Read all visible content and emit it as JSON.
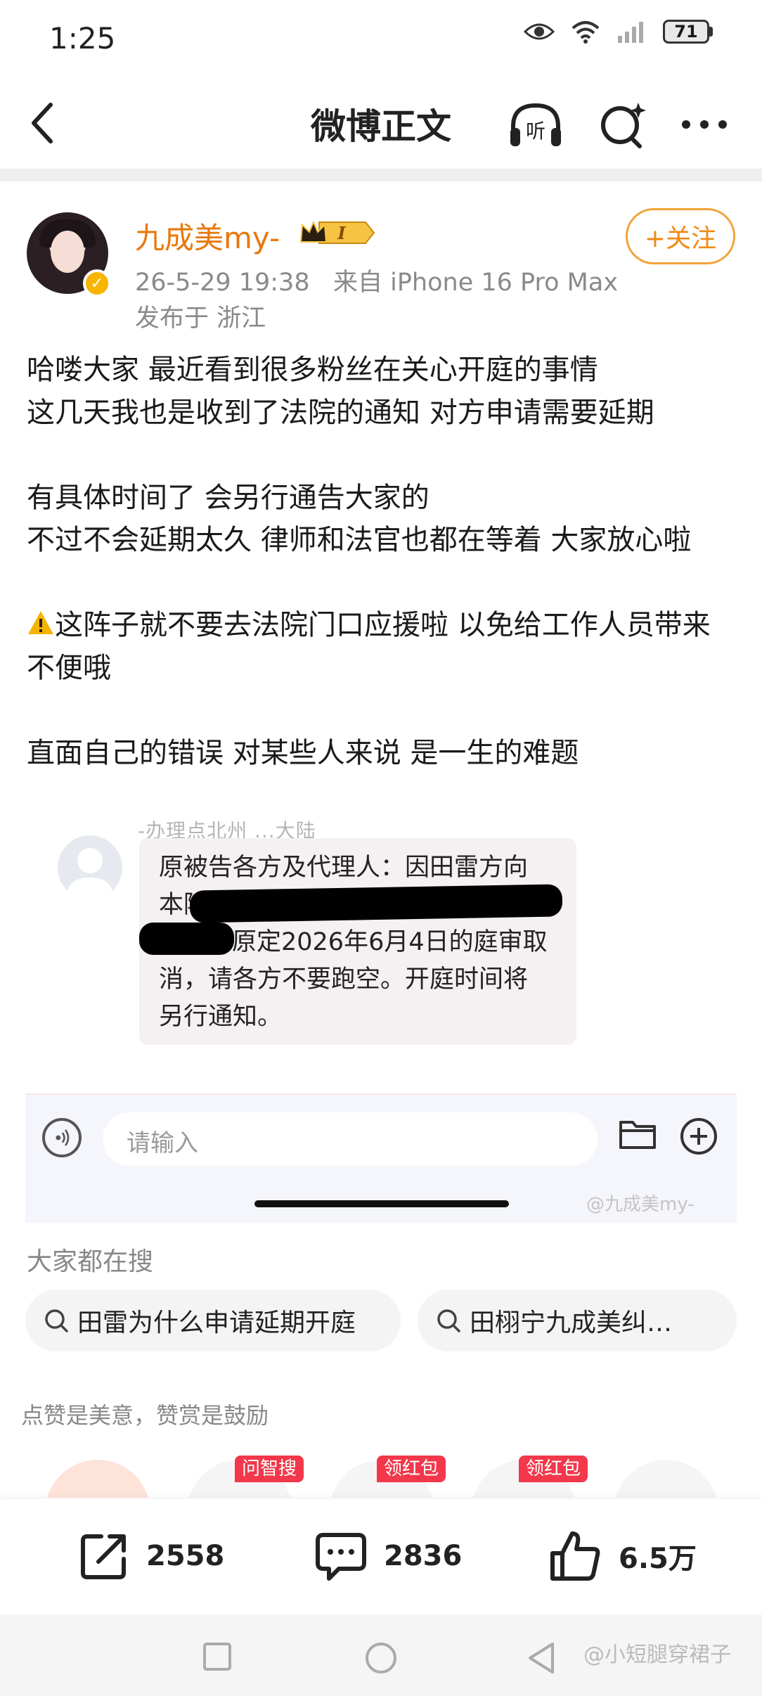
{
  "status_bar": {
    "time": "1:25",
    "battery": "71"
  },
  "nav": {
    "title": "微博正文"
  },
  "post": {
    "username": "九成美my-",
    "vip_level": "I",
    "meta": "26-5-29 19:38   来自 iPhone 16 Pro Max",
    "location": "发布于 浙江",
    "follow_label": "+关注",
    "paragraphs": {
      "p1": "哈喽大家 最近看到很多粉丝在关心开庭的事情",
      "p2": "这几天我也是收到了法院的通知 对方申请需要延期",
      "p3": "有具体时间了 会另行通告大家的",
      "p4": "不过不会延期太久 律师和法官也都在等着 大家放心啦",
      "p5": "这阵子就不要去法院门口应援啦 以免给工作人员带来不便哦",
      "p6": "直面自己的错误 对某些人来说 是一生的难题"
    }
  },
  "embedded": {
    "faded_line": "-办理点北州 ...大陆",
    "message_line1": "原被告各方及代理人：因田雷方向",
    "message_line2": "本院",
    "message_line3": "原定2026年6月4日的庭审取",
    "message_line4": "消，请各方不要跑空。开庭时间将",
    "message_line5": "另行通知。",
    "input_placeholder": "请输入",
    "watermark": "@九成美my-"
  },
  "hot_search": {
    "title": "大家都在搜",
    "items": [
      "田雷为什么申请延期开庭",
      "田栩宁九成美纠…"
    ]
  },
  "reward": {
    "title": "点赞是美意，赞赏是鼓励",
    "tags": [
      "问智搜",
      "领红包",
      "领红包"
    ]
  },
  "actions": {
    "repost": "2558",
    "comment": "2836",
    "like": "6.5万"
  },
  "bottom_watermark": "@小短腿穿裙子",
  "colors": {
    "accent": "#ef8a14",
    "follow_border": "#f2a33a",
    "tag_red": "#f2384a"
  }
}
